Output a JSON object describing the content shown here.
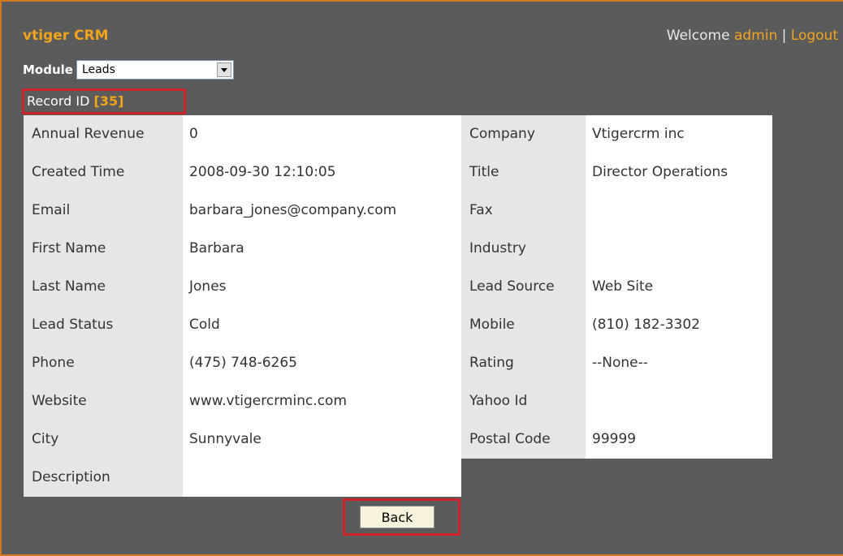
{
  "header": {
    "app_title": "vtiger CRM",
    "welcome_text": "Welcome",
    "user": "admin",
    "separator": "|",
    "logout": "Logout"
  },
  "module_selector": {
    "label": "Module",
    "selected": "Leads"
  },
  "record": {
    "label": "Record ID",
    "open_bracket": "[",
    "id": "35",
    "close_bracket": "]"
  },
  "fields_left": [
    {
      "label": "Annual Revenue",
      "value": "0"
    },
    {
      "label": "Created Time",
      "value": "2008-09-30 12:10:05"
    },
    {
      "label": "Email",
      "value": "barbara_jones@company.com"
    },
    {
      "label": "First Name",
      "value": "Barbara"
    },
    {
      "label": "Last Name",
      "value": "Jones"
    },
    {
      "label": "Lead Status",
      "value": "Cold"
    },
    {
      "label": "Phone",
      "value": "(475) 748-6265"
    },
    {
      "label": "Website",
      "value": "www.vtigercrminc.com"
    },
    {
      "label": "City",
      "value": "Sunnyvale"
    },
    {
      "label": "Description",
      "value": ""
    }
  ],
  "fields_right": [
    {
      "label": "Company",
      "value": "Vtigercrm inc"
    },
    {
      "label": "Title",
      "value": "Director Operations"
    },
    {
      "label": "Fax",
      "value": ""
    },
    {
      "label": "Industry",
      "value": ""
    },
    {
      "label": "Lead Source",
      "value": "Web Site"
    },
    {
      "label": "Mobile",
      "value": "(810) 182-3302"
    },
    {
      "label": "Rating",
      "value": "--None--"
    },
    {
      "label": "Yahoo Id",
      "value": ""
    },
    {
      "label": "Postal Code",
      "value": "99999"
    }
  ],
  "actions": {
    "back_label": "Back"
  },
  "colors": {
    "background": "#5b5b5b",
    "accent": "#f2a51c",
    "highlight_border": "#cc2229",
    "label_bg": "#e6e6e6"
  },
  "icons": {
    "dropdown": "chevron-down-icon"
  }
}
